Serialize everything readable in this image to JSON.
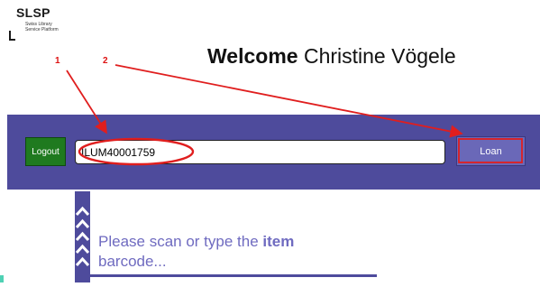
{
  "logo": {
    "name": "SLSP",
    "subtitle_line1": "Swiss Library",
    "subtitle_line2": "Service Platform"
  },
  "header": {
    "welcome_word": "Welcome",
    "user_name": "Christine Vögele"
  },
  "toolbar": {
    "logout_label": "Logout",
    "barcode_value": "ILUM40001759",
    "loan_label": "Loan"
  },
  "hint": {
    "prefix": "Please scan or type the ",
    "keyword": "item",
    "suffix": "barcode..."
  },
  "annotations": {
    "label_1": "1",
    "label_2": "2",
    "color": "#e01e1e"
  },
  "colors": {
    "bar": "#4e4b9c",
    "logout_button": "#1f7a1f",
    "loan_button": "#6a68b8",
    "hint_text": "#6f6bc0"
  }
}
